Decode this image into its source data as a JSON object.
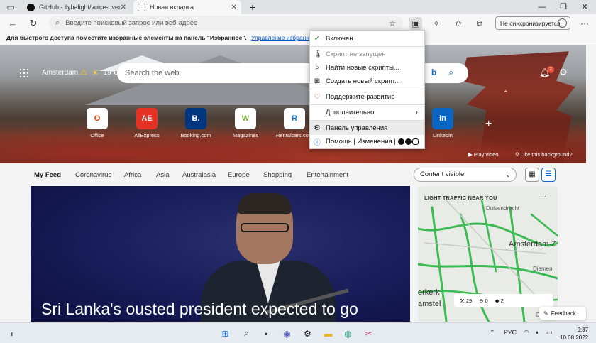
{
  "browser": {
    "tabs": [
      {
        "label": "GitHub - ilyhalight/voice-over-tr",
        "close": "✕"
      },
      {
        "label": "Новая вкладка",
        "close": "✕"
      }
    ],
    "new_tab": "+",
    "window_controls": {
      "minimize": "—",
      "maximize": "❐",
      "close": "✕"
    },
    "address_placeholder": "Введите поисковый запрос или веб-адрес",
    "sync_label": "Не синхронизируется",
    "favbar_text": "Для быстрого доступа поместите избранные элементы на панель \"Избранное\".",
    "favbar_link": "Управление избранным"
  },
  "newtab": {
    "city": "Amsterdam",
    "temp": "19°C",
    "search_placeholder": "Search the web",
    "notifications_count": "2",
    "quick_links": [
      {
        "label": "Office",
        "glyph": "O",
        "color": "#d83b01"
      },
      {
        "label": "AliExpress",
        "glyph": "AE",
        "color": "#e43225"
      },
      {
        "label": "Booking.com",
        "glyph": "B.",
        "color": "#003580"
      },
      {
        "label": "Magazines",
        "glyph": "W",
        "color": "#7cb342"
      },
      {
        "label": "Rentalcars.com",
        "glyph": "R",
        "color": "#1a73c9"
      },
      {
        "label": "Linkedin",
        "glyph": "in",
        "color": "#0a66c2"
      }
    ],
    "play_video": "Play video",
    "like_bg": "Like this background?"
  },
  "feed": {
    "nav": [
      "My Feed",
      "Coronavirus",
      "Africa",
      "Asia",
      "Australasia",
      "Europe",
      "Shopping",
      "Entertainment"
    ],
    "content_visible": "Content visible",
    "headline": "Sri Lanka's ousted president expected to go",
    "traffic": {
      "title": "LIGHT TRAFFIC NEAR YOU",
      "more": "···",
      "labels": [
        "Duivendrecht",
        "Amsterdam-Z",
        "Diemen",
        "erkerk",
        "amstel",
        "Ouder"
      ],
      "stats": [
        "29",
        "0",
        "2"
      ]
    },
    "feedback": "Feedback"
  },
  "extension_menu": {
    "items": [
      {
        "icon": "✓",
        "label": "Включен"
      },
      {
        "icon": "🌡",
        "label": "Скрипт не запущен"
      },
      {
        "icon": "⌕",
        "label": "Найти новые скрипты..."
      },
      {
        "icon": "⊞",
        "label": "Создать новый скрипт..."
      },
      {
        "icon": "♡",
        "label": "Поддержите развитие"
      },
      {
        "icon": "",
        "label": "Дополнительно"
      },
      {
        "icon": "⚙",
        "label": "Панель управления"
      },
      {
        "icon": "ⓘ",
        "label": "Помощь | Изменения |"
      }
    ],
    "submenu_arrow": "›"
  },
  "taskbar": {
    "lang": "РУС",
    "time": "9:37",
    "date": "10.08.2022"
  },
  "colors": {
    "accent": "#0b6ad6",
    "news_bg": "#161a55",
    "traffic_green": "#3cba54"
  }
}
